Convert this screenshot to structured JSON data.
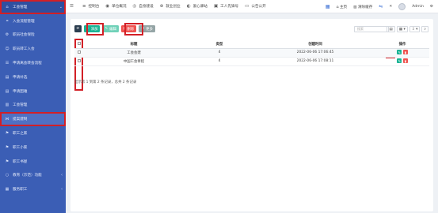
{
  "sidebar": {
    "items": [
      {
        "label": "工会管理",
        "icon": "home-icon",
        "arrow": "⌄"
      },
      {
        "label": "入会流程管理",
        "icon": "link-icon",
        "arrow": ""
      },
      {
        "label": "职员社会保险",
        "icon": "gear-icon",
        "arrow": ""
      },
      {
        "label": "职员转工入会",
        "icon": "users-icon",
        "arrow": ""
      },
      {
        "label": "申请离会转会流程",
        "icon": "list-icon",
        "arrow": ""
      },
      {
        "label": "申请补选",
        "icon": "doc-icon",
        "arrow": ""
      },
      {
        "label": "申请困难",
        "icon": "doc-icon",
        "arrow": ""
      },
      {
        "label": "工会管理",
        "icon": "book-icon",
        "arrow": ""
      },
      {
        "label": "提案建制",
        "icon": "share-icon",
        "arrow": ""
      },
      {
        "label": "职工之家",
        "icon": "flag-icon",
        "arrow": ""
      },
      {
        "label": "职工小家",
        "icon": "flag-icon",
        "arrow": ""
      },
      {
        "label": "职工书屋",
        "icon": "flag-icon",
        "arrow": ""
      },
      {
        "label": "教育（示范）功能",
        "icon": "circle-icon",
        "arrow": "‹"
      },
      {
        "label": "服务职工",
        "icon": "grid-icon",
        "arrow": "‹"
      }
    ]
  },
  "topbar": {
    "menus": [
      {
        "label": "控制台",
        "icon": "≡"
      },
      {
        "label": "单位概况",
        "icon": "◉"
      },
      {
        "label": "自身建设",
        "icon": "◎"
      },
      {
        "label": "就业创业",
        "icon": "⊕"
      },
      {
        "label": "爱心驿站",
        "icon": "◐"
      },
      {
        "label": "工人先锋号",
        "icon": "▣"
      },
      {
        "label": "公告公开",
        "icon": "▭"
      }
    ],
    "right": {
      "home_label": "主页",
      "clear_label": "清除缓存",
      "user_label": "Admin"
    }
  },
  "toolbar": {
    "refresh_icon": "⟳",
    "add_label": "添加",
    "edit_label": "编辑",
    "delete_label": "删除",
    "more_label": "更多"
  },
  "search": {
    "placeholder": "搜索"
  },
  "table": {
    "headers": [
      "标题",
      "类型",
      "创建时间",
      "操作"
    ],
    "rows": [
      {
        "title": "工会会建",
        "type": "4",
        "created": "2022-06-06 17:06:45"
      },
      {
        "title": "中国工会章程",
        "type": "4",
        "created": "2022-06-06 17:08:11"
      }
    ]
  },
  "footer": {
    "text": "显示第 1 到第 2 条记录，总共 2 条记录"
  }
}
